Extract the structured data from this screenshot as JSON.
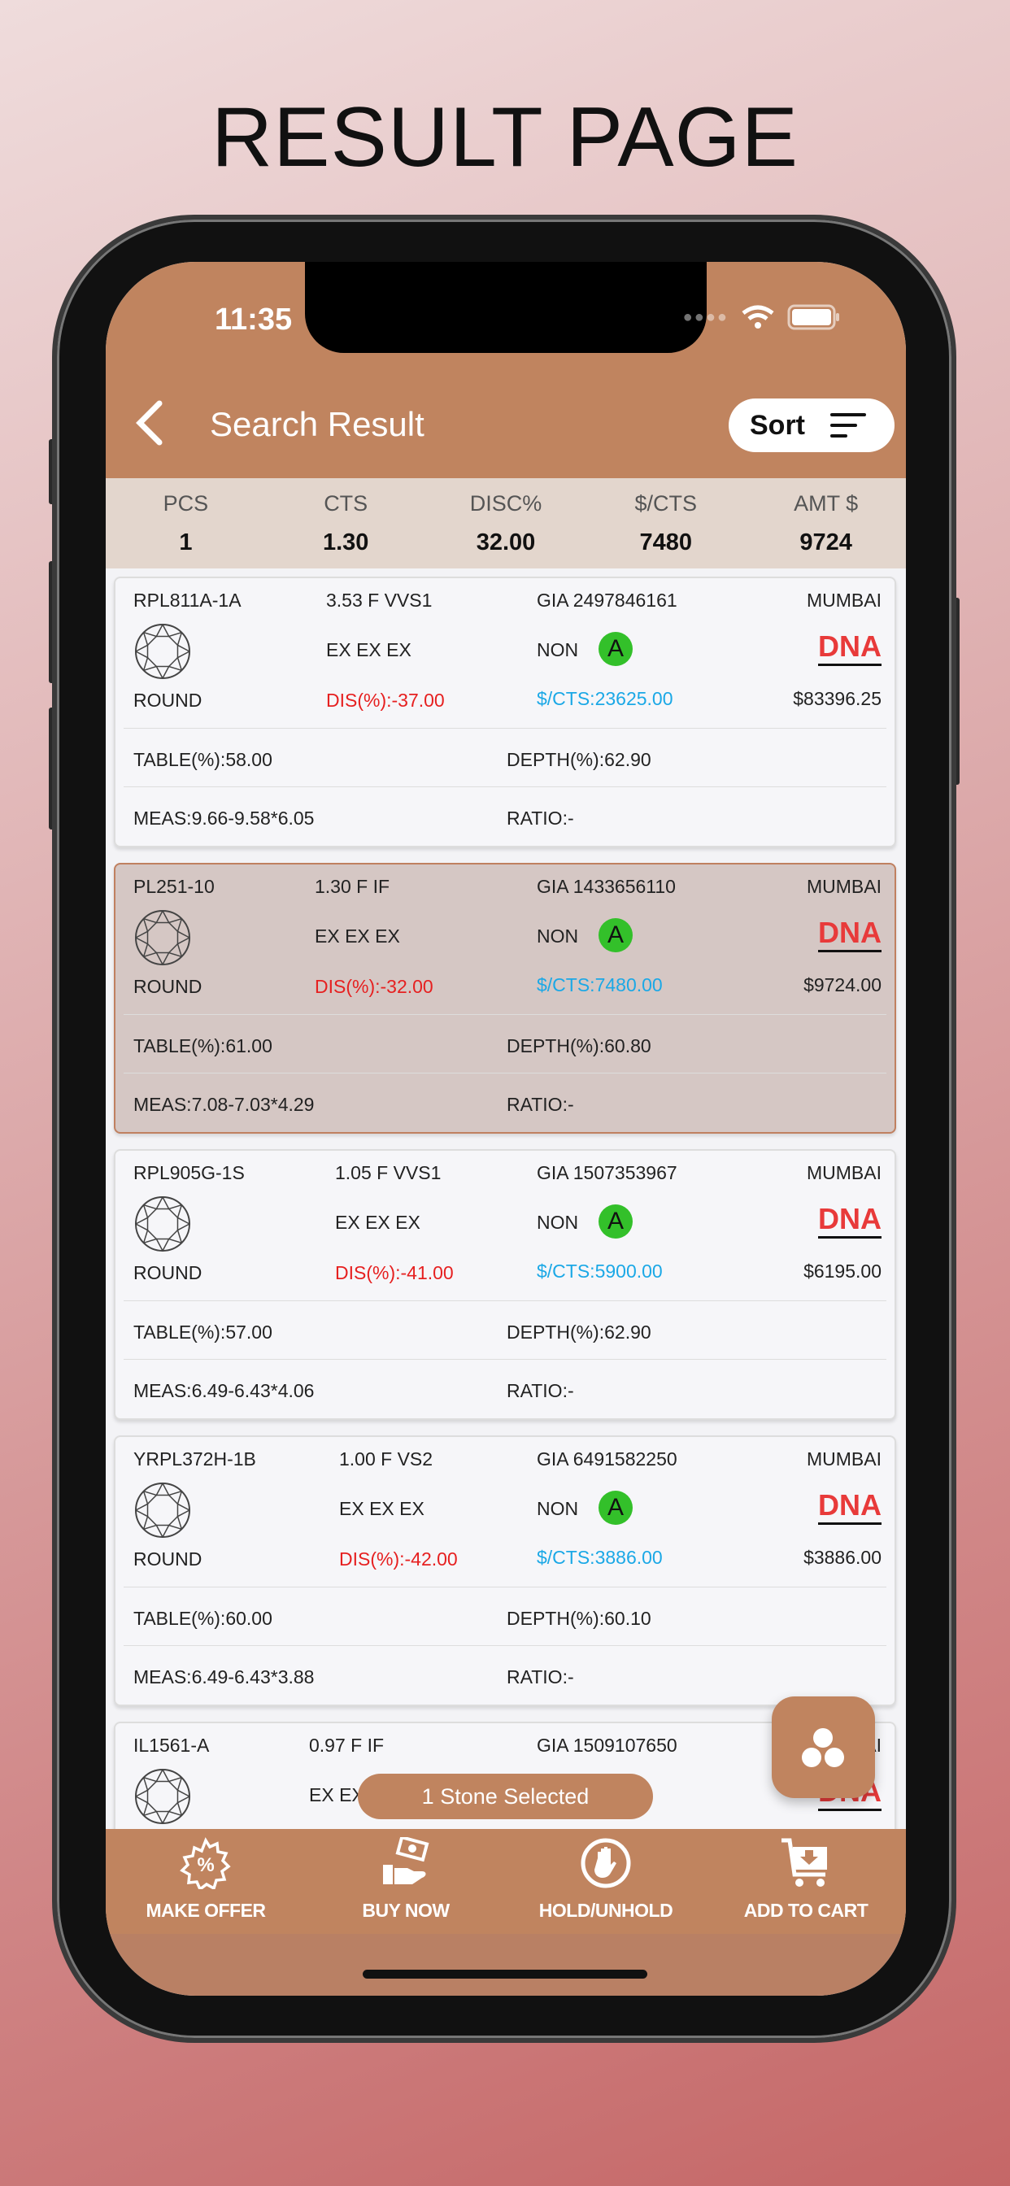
{
  "page_title": "RESULT PAGE",
  "status_bar": {
    "time": "11:35"
  },
  "nav": {
    "title": "Search Result",
    "sort_label": "Sort"
  },
  "summary": [
    {
      "label": "PCS",
      "value": "1"
    },
    {
      "label": "CTS",
      "value": "1.30"
    },
    {
      "label": "DISC%",
      "value": "32.00"
    },
    {
      "label": "$/CTS",
      "value": "7480"
    },
    {
      "label": "AMT $",
      "value": "9724"
    }
  ],
  "stones": [
    {
      "id": "RPL811A-1A",
      "spec": "3.53 F VVS1",
      "cert": "GIA 2497846161",
      "location": "MUMBAI",
      "cut": "EX EX EX",
      "fluor": "NON",
      "badge": "A",
      "dna": "DNA",
      "shape": "ROUND",
      "disc": "DIS(%):-37.00",
      "per_ct": "$/CTS:23625.00",
      "amount": "$83396.25",
      "table": "TABLE(%):58.00",
      "depth": "DEPTH(%):62.90",
      "meas": "MEAS:9.66-9.58*6.05",
      "ratio": "RATIO:-",
      "selected": false
    },
    {
      "id": "PL251-10",
      "spec": "1.30 F IF",
      "cert": "GIA 1433656110",
      "location": "MUMBAI",
      "cut": "EX EX EX",
      "fluor": "NON",
      "badge": "A",
      "dna": "DNA",
      "shape": "ROUND",
      "disc": "DIS(%):-32.00",
      "per_ct": "$/CTS:7480.00",
      "amount": "$9724.00",
      "table": "TABLE(%):61.00",
      "depth": "DEPTH(%):60.80",
      "meas": "MEAS:7.08-7.03*4.29",
      "ratio": "RATIO:-",
      "selected": true
    },
    {
      "id": "RPL905G-1S",
      "spec": "1.05 F VVS1",
      "cert": "GIA 1507353967",
      "location": "MUMBAI",
      "cut": "EX EX EX",
      "fluor": "NON",
      "badge": "A",
      "dna": "DNA",
      "shape": "ROUND",
      "disc": "DIS(%):-41.00",
      "per_ct": "$/CTS:5900.00",
      "amount": "$6195.00",
      "table": "TABLE(%):57.00",
      "depth": "DEPTH(%):62.90",
      "meas": "MEAS:6.49-6.43*4.06",
      "ratio": "RATIO:-",
      "selected": false
    },
    {
      "id": "YRPL372H-1B",
      "spec": "1.00 F VS2",
      "cert": "GIA 6491582250",
      "location": "MUMBAI",
      "cut": "EX EX EX",
      "fluor": "NON",
      "badge": "A",
      "dna": "DNA",
      "shape": "ROUND",
      "disc": "DIS(%):-42.00",
      "per_ct": "$/CTS:3886.00",
      "amount": "$3886.00",
      "table": "TABLE(%):60.00",
      "depth": "DEPTH(%):60.10",
      "meas": "MEAS:6.49-6.43*3.88",
      "ratio": "RATIO:-",
      "selected": false
    },
    {
      "id": "IL1561-A",
      "spec": "0.97 F IF",
      "cert": "GIA 1509107650",
      "location": "MUMBAI",
      "cut": "EX EX EX",
      "dna": "DNA",
      "selected": false
    }
  ],
  "toast": "1 Stone Selected",
  "actions": [
    {
      "label": "MAKE OFFER",
      "icon": "percent-badge-icon"
    },
    {
      "label": "BUY NOW",
      "icon": "hand-money-icon"
    },
    {
      "label": "HOLD/UNHOLD",
      "icon": "hand-stop-icon"
    },
    {
      "label": "ADD TO CART",
      "icon": "cart-download-icon"
    }
  ],
  "colors": {
    "brand": "#c0845f",
    "discount": "#e62020",
    "price_per_ct": "#1ba8e6",
    "badge": "#33c02a",
    "dna": "#e83a3a"
  }
}
